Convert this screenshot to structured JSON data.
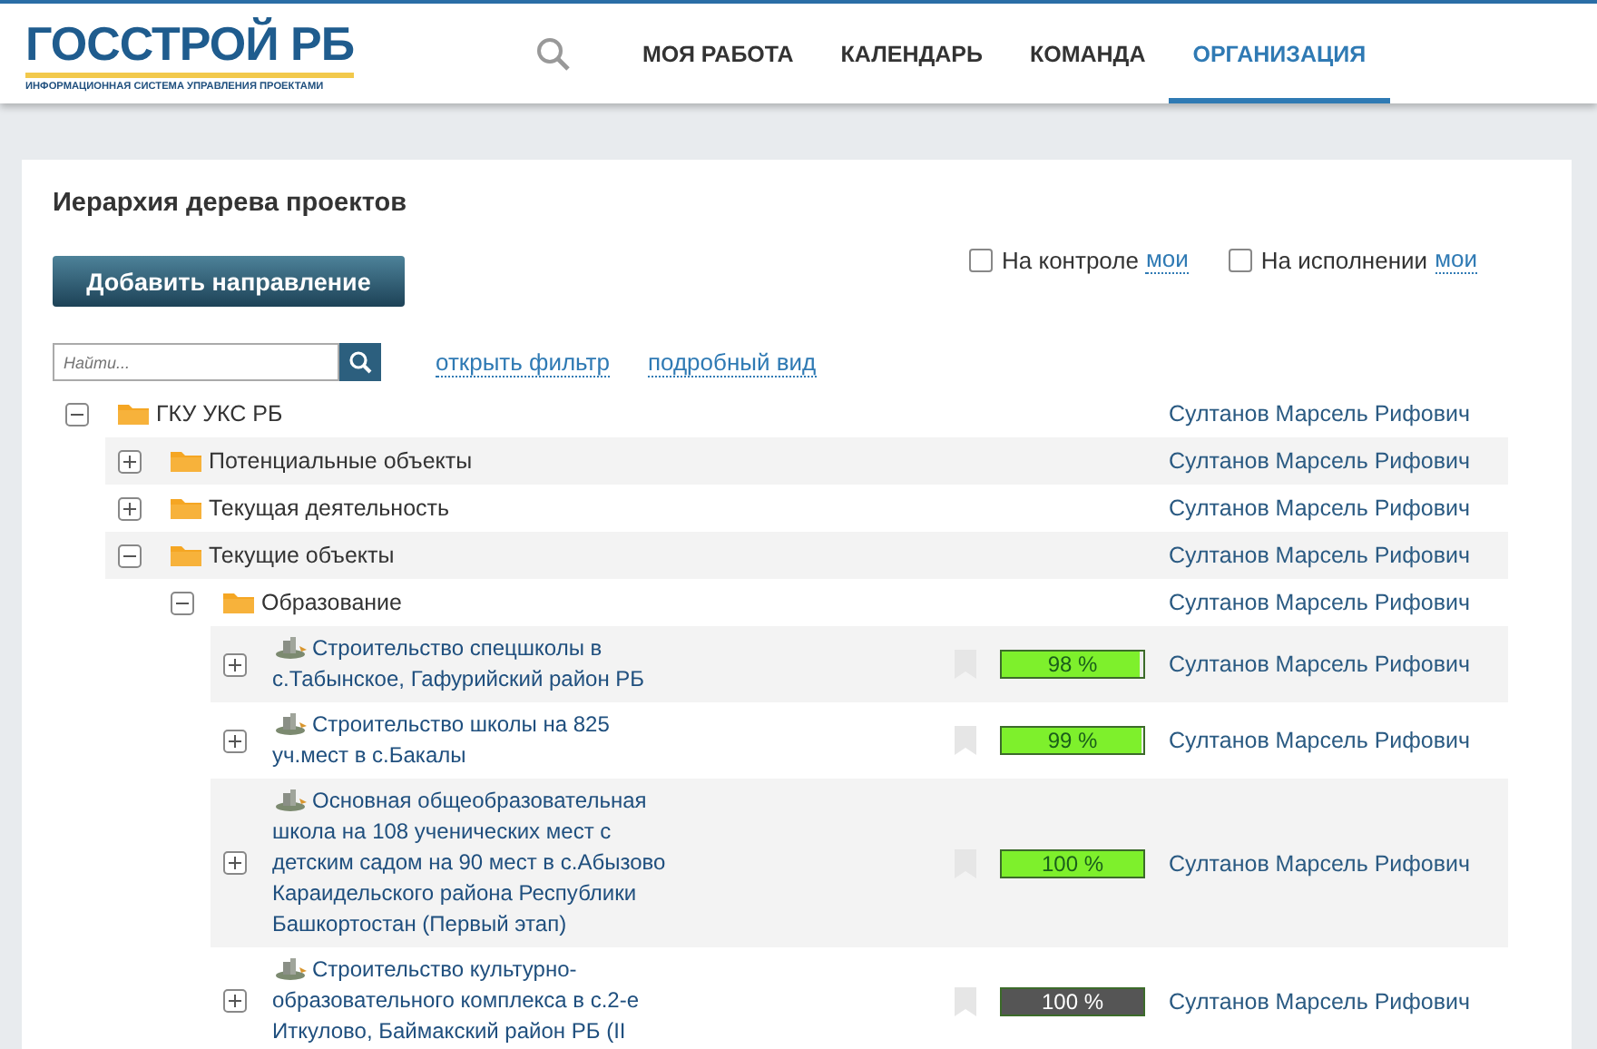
{
  "header": {
    "logo": "ГОССТРОЙ РБ",
    "logo_subtitle": "ИНФОРМАЦИОННАЯ СИСТЕМА УПРАВЛЕНИЯ ПРОЕКТАМИ",
    "nav": [
      {
        "label": "МОЯ РАБОТА",
        "selected": false
      },
      {
        "label": "КАЛЕНДАРЬ",
        "selected": false
      },
      {
        "label": "КОМАНДА",
        "selected": false
      },
      {
        "label": "ОРГАНИЗАЦИЯ",
        "selected": true
      }
    ]
  },
  "panel": {
    "title": "Иерархия дерева проектов",
    "add_button": "Добавить направление",
    "filters": [
      {
        "label": "На контроле",
        "checked": false,
        "link": "мои"
      },
      {
        "label": "На исполнении",
        "checked": false,
        "link": "мои"
      }
    ],
    "search": {
      "placeholder": "Найти..."
    },
    "links": [
      "открыть фильтр",
      "подробный вид"
    ]
  },
  "tree": [
    {
      "kind": "folder",
      "name": "ГКУ УКС РБ",
      "expanded": true,
      "owner": "Султанов Марсель Рифович",
      "children": [
        {
          "kind": "folder",
          "name": "Потенциальные объекты",
          "expanded": false,
          "owner": "Султанов Марсель Рифович"
        },
        {
          "kind": "folder",
          "name": "Текущая деятельность",
          "expanded": false,
          "owner": "Султанов Марсель Рифович"
        },
        {
          "kind": "folder",
          "name": "Текущие объекты",
          "expanded": true,
          "owner": "Султанов Марсель Рифович",
          "children": [
            {
              "kind": "folder",
              "name": "Образование",
              "expanded": true,
              "owner": "Султанов Марсель Рифович",
              "children": [
                {
                  "kind": "project",
                  "name": "Строительство спецшколы в с.Табынское, Гафурийский район РБ",
                  "expanded": false,
                  "progress": "98 %",
                  "level": 0.98,
                  "color": "#7ef02c",
                  "owner": "Султанов Марсель Рифович"
                },
                {
                  "kind": "project",
                  "name": "Строительство школы на 825 уч.мест в с.Бакалы",
                  "expanded": false,
                  "progress": "99 %",
                  "level": 0.99,
                  "color": "#7ef02c",
                  "owner": "Султанов Марсель Рифович"
                },
                {
                  "kind": "project",
                  "name": "Основная общеобразовательная школа на 108 ученических мест с детским садом на 90 мест в с.Абызово Караидельского района Республики Башкортостан (Первый этап)",
                  "expanded": false,
                  "progress": "100 %",
                  "level": 1,
                  "color": "#7ef02c",
                  "owner": "Султанов Марсель Рифович"
                },
                {
                  "kind": "project",
                  "name": "Строительство культурно-образовательного комплекса в с.2-е Иткулово, Баймакский район РБ (II",
                  "expanded": false,
                  "progress": "100 %",
                  "level": 1,
                  "color": "#555555",
                  "owner": "Султанов Марсель Рифович"
                }
              ]
            }
          ]
        }
      ]
    }
  ]
}
